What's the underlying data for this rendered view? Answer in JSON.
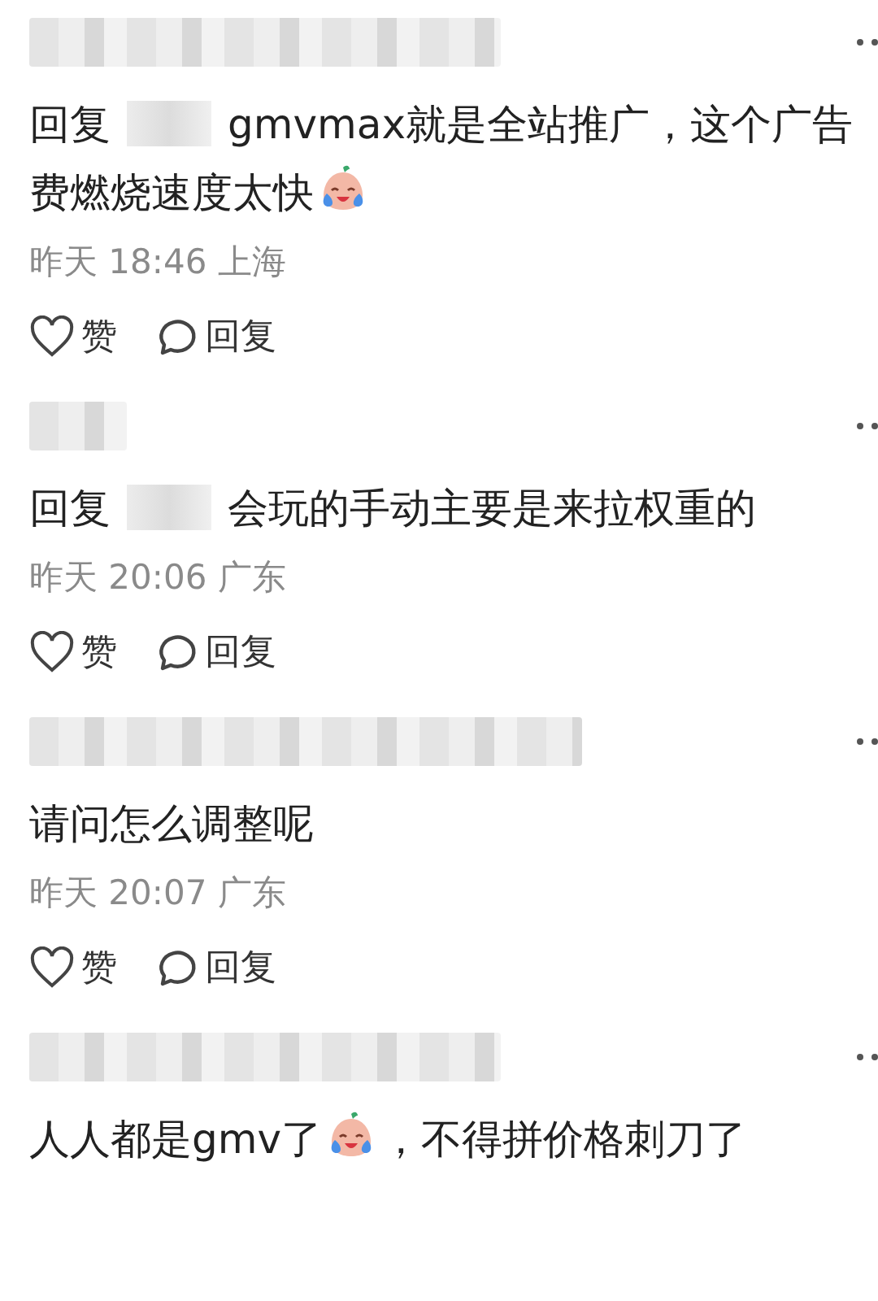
{
  "comments": [
    {
      "body": [
        {
          "kind": "text",
          "text": "回复"
        },
        {
          "kind": "redacted"
        },
        {
          "kind": "text",
          "text": "gmvmax就是全站推广，这个广告费燃烧速度太快"
        },
        {
          "kind": "emoji"
        }
      ],
      "time": "昨天 18:46 上海",
      "like": "赞",
      "reply": "回复"
    },
    {
      "body": [
        {
          "kind": "text",
          "text": "回复"
        },
        {
          "kind": "redacted"
        },
        {
          "kind": "text",
          "text": "会玩的手动主要是来拉权重的"
        }
      ],
      "time": "昨天 20:06 广东",
      "like": "赞",
      "reply": "回复"
    },
    {
      "body": [
        {
          "kind": "text",
          "text": "请问怎么调整呢"
        }
      ],
      "time": "昨天 20:07 广东",
      "like": "赞",
      "reply": "回复"
    },
    {
      "body": [
        {
          "kind": "text",
          "text": "人人都是gmv了"
        },
        {
          "kind": "emoji"
        },
        {
          "kind": "text",
          "text": "，不得拼价格刺刀了"
        }
      ]
    }
  ]
}
